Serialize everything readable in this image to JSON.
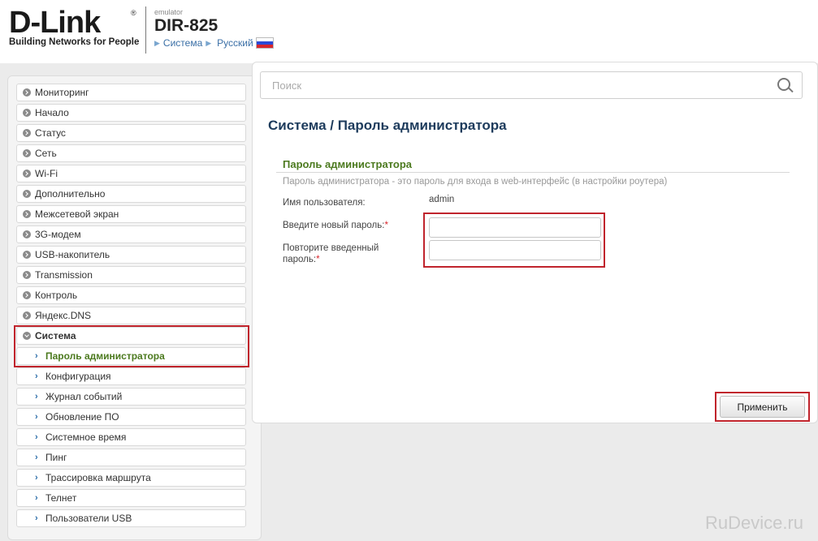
{
  "header": {
    "logo_text": "D-Link",
    "logo_registered": "®",
    "logo_tagline": "Building Networks for People",
    "emulator_label": "emulator",
    "model": "DIR-825",
    "breadcrumb": {
      "system": "Система",
      "language": "Русский"
    }
  },
  "search": {
    "placeholder": "Поиск"
  },
  "sidebar": {
    "items": [
      {
        "label": "Мониторинг"
      },
      {
        "label": "Начало"
      },
      {
        "label": "Статус"
      },
      {
        "label": "Сеть"
      },
      {
        "label": "Wi-Fi"
      },
      {
        "label": "Дополнительно"
      },
      {
        "label": "Межсетевой экран"
      },
      {
        "label": "3G-модем"
      },
      {
        "label": "USB-накопитель"
      },
      {
        "label": "Transmission"
      },
      {
        "label": "Контроль"
      },
      {
        "label": "Яндекс.DNS"
      },
      {
        "label": "Система"
      }
    ],
    "subitems": [
      {
        "label": "Пароль администратора"
      },
      {
        "label": "Конфигурация"
      },
      {
        "label": "Журнал событий"
      },
      {
        "label": "Обновление ПО"
      },
      {
        "label": "Системное время"
      },
      {
        "label": "Пинг"
      },
      {
        "label": "Трассировка маршрута"
      },
      {
        "label": "Телнет"
      },
      {
        "label": "Пользователи USB"
      }
    ]
  },
  "main": {
    "title": "Система /  Пароль администратора",
    "section_title": "Пароль администратора",
    "section_desc": "Пароль администратора - это пароль для входа в web-интерфейс (в настройки роутера)",
    "username_label": "Имя пользователя:",
    "username_value": "admin",
    "new_password_label": "Введите новый пароль:",
    "repeat_password_label_1": "Повторите введенный",
    "repeat_password_label_2": "пароль:",
    "required_mark": "*",
    "apply_label": "Применить"
  },
  "watermark": "RuDevice.ru",
  "colors": {
    "accent_red": "#c0242c",
    "section_green": "#4c7a1f",
    "title_navy": "#1d3b5c"
  }
}
